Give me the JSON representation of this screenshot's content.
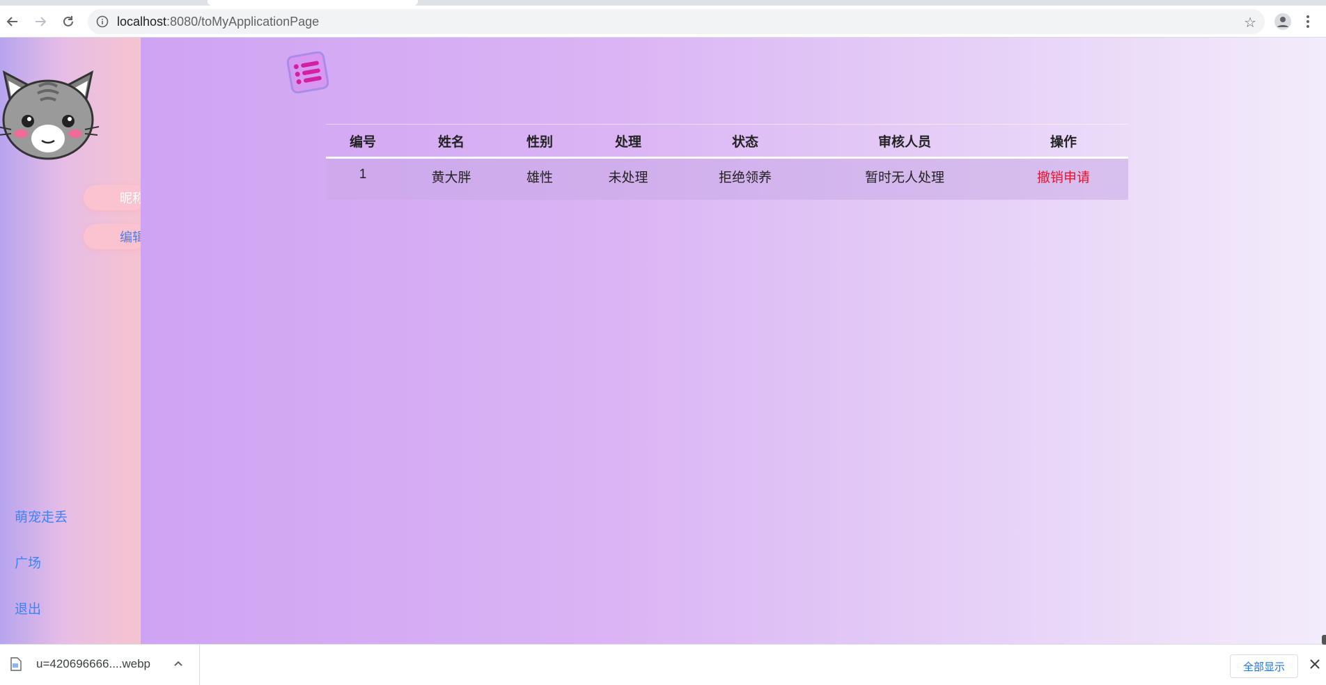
{
  "browser": {
    "url_host": "localhost",
    "url_path": ":8080/toMyApplicationPage"
  },
  "sidebar": {
    "nickname_label": "昵称",
    "edit_label": "编辑",
    "links": [
      "萌宠走丢",
      "广场",
      "退出"
    ]
  },
  "table": {
    "headers": [
      "编号",
      "姓名",
      "性别",
      "处理",
      "状态",
      "审核人员",
      "操作"
    ],
    "rows": [
      [
        "1",
        "黄大胖",
        "雄性",
        "未处理",
        "拒绝领养",
        "暂时无人处理",
        "撤销申请"
      ]
    ]
  },
  "download": {
    "filename": "u=420696666....webp",
    "show_all_label": "全部显示"
  },
  "colors": {
    "accent_link": "#3d83f5",
    "cancel_red": "#e8152b",
    "menu_icon": "#d21fa3"
  }
}
